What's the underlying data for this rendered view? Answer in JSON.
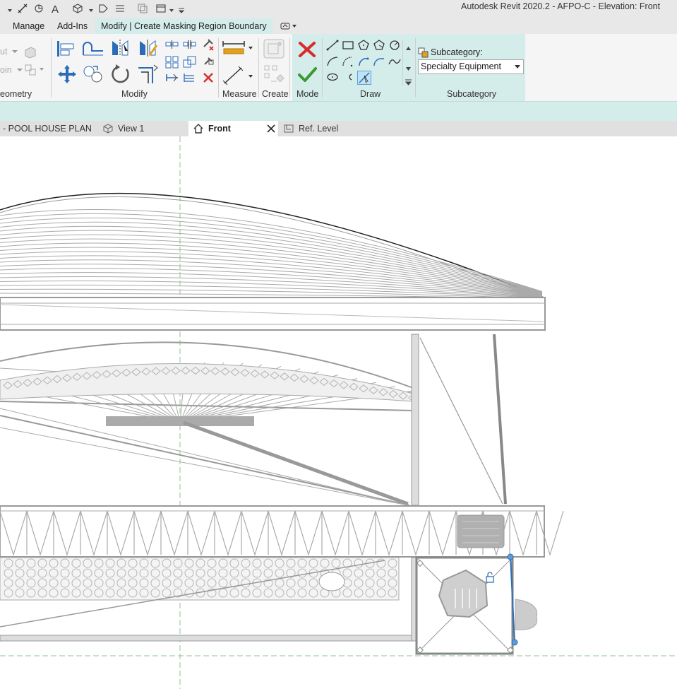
{
  "app": {
    "title": "Autodesk Revit 2020.2 - AFPO-C - Elevation: Front"
  },
  "quick_access": {
    "icons": [
      "dimension-icon",
      "measure-icon",
      "text-icon",
      "3d-view-icon",
      "tag-icon",
      "thin-lines-icon",
      "close-views-icon",
      "switch-windows-icon",
      "customize-icon"
    ]
  },
  "ribbon_tabs": [
    {
      "label": "Manage"
    },
    {
      "label": "Add-Ins"
    },
    {
      "label": "Modify | Create Masking Region Boundary",
      "active": true
    }
  ],
  "panels": {
    "geometry": {
      "label": "eometry",
      "cut_label": "ut",
      "join_label": "oin"
    },
    "modify": {
      "label": "Modify"
    },
    "measure": {
      "label": "Measure"
    },
    "create": {
      "label": "Create"
    },
    "mode": {
      "label": "Mode"
    },
    "draw": {
      "label": "Draw"
    },
    "subcategory": {
      "label": "Subcategory",
      "field_label": "Subcategory:",
      "selected": "Specialty Equipment"
    }
  },
  "view_tabs": [
    {
      "label": "- POOL HOUSE PLAN"
    },
    {
      "label": "View 1"
    },
    {
      "label": "Front",
      "active": true
    },
    {
      "label": "Ref. Level"
    }
  ],
  "colors": {
    "ribbon_context": "#d4ecea",
    "cancel_red": "#d92a2a",
    "finish_green": "#3a9a2e",
    "drawing_gray": "#9a9a9a",
    "selection_blue": "#2f6fb5"
  }
}
